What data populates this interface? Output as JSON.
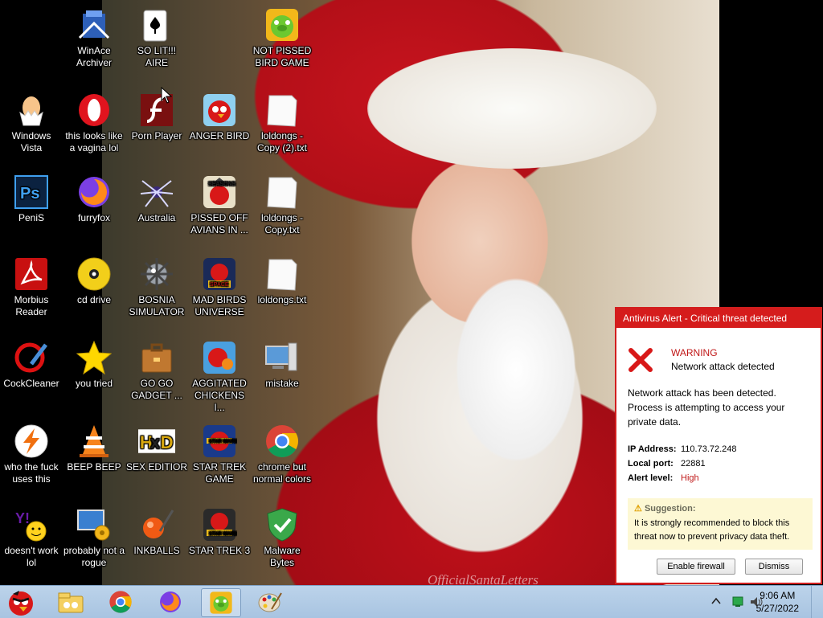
{
  "desktop_icons": [
    {
      "name": "winace-archiver",
      "label": "WinAce Archiver",
      "icon": "archive-icon"
    },
    {
      "name": "solitaire",
      "label": "SO LIT!!! AIRE",
      "icon": "cards-icon"
    },
    {
      "name": "not-pissed-bird",
      "label": "NOT PISSED BIRD GAME",
      "icon": "pig-icon"
    },
    {
      "name": "windows-vista",
      "label": "Windows Vista",
      "icon": "egg-icon"
    },
    {
      "name": "opera",
      "label": "this looks like a vagina lol",
      "icon": "opera-icon"
    },
    {
      "name": "porn-player",
      "label": "Porn Player",
      "icon": "flash-icon"
    },
    {
      "name": "anger-bird",
      "label": "ANGER BIRD",
      "icon": "red-bird-icon"
    },
    {
      "name": "loldongs-copy2",
      "label": "loldongs - Copy (2).txt",
      "icon": "text-file-icon"
    },
    {
      "name": "photoshop",
      "label": "PeniS",
      "icon": "photoshop-icon"
    },
    {
      "name": "firefox",
      "label": "furryfox",
      "icon": "firefox-icon"
    },
    {
      "name": "australia",
      "label": "Australia",
      "icon": "spider-icon"
    },
    {
      "name": "pissed-off-avians",
      "label": "PISSED OFF AVIANS IN ...",
      "icon": "seasons-bird-icon"
    },
    {
      "name": "loldongs-copy",
      "label": "loldongs - Copy.txt",
      "icon": "text-file-icon"
    },
    {
      "name": "morbius-reader",
      "label": "Morbius Reader",
      "icon": "pdf-icon"
    },
    {
      "name": "cd-drive",
      "label": "cd drive",
      "icon": "cd-icon"
    },
    {
      "name": "bosnia-simulator",
      "label": "BOSNIA SIMULATOR",
      "icon": "mine-icon"
    },
    {
      "name": "mad-birds-universe",
      "label": "MAD BIRDS UNIVERSE",
      "icon": "space-bird-icon"
    },
    {
      "name": "loldongs",
      "label": "loldongs.txt",
      "icon": "text-file-icon"
    },
    {
      "name": "cockcleaner",
      "label": "CockCleaner",
      "icon": "broom-icon"
    },
    {
      "name": "you-tried",
      "label": "you tried",
      "icon": "star-icon"
    },
    {
      "name": "go-go-gadget",
      "label": "GO GO GADGET ...",
      "icon": "briefcase-icon"
    },
    {
      "name": "aggitated-chickens",
      "label": "AGGITATED CHICKENS I...",
      "icon": "rio-bird-icon"
    },
    {
      "name": "mistake",
      "label": "mistake",
      "icon": "computer-icon"
    },
    {
      "name": "who-uses-this",
      "label": "who the fuck uses this",
      "icon": "winamp-icon"
    },
    {
      "name": "beep-beep",
      "label": "BEEP BEEP",
      "icon": "vlc-icon"
    },
    {
      "name": "sex-editior",
      "label": "SEX EDITIOR",
      "icon": "hxd-icon"
    },
    {
      "name": "star-trek-game",
      "label": "STAR TREK GAME",
      "icon": "starwars-bird-icon"
    },
    {
      "name": "chrome",
      "label": "chrome but normal colors",
      "icon": "chrome-icon"
    },
    {
      "name": "doesnt-work",
      "label": "doesn't work lol",
      "icon": "yahoo-icon"
    },
    {
      "name": "probably-not-rogue",
      "label": "probably not a rogue",
      "icon": "monitor-gears-icon"
    },
    {
      "name": "inkballs",
      "label": "INKBALLS",
      "icon": "inkball-icon"
    },
    {
      "name": "star-trek-3",
      "label": "STAR TREK 3",
      "icon": "starwars-bird2-icon"
    },
    {
      "name": "malware-bytes",
      "label": "Malware Bytes",
      "icon": "shield-check-icon"
    }
  ],
  "wallpaper": {
    "watermark": "OfficialSantaLetters"
  },
  "antivirus": {
    "title": "Antivirus Alert - Critical threat detected",
    "warning_title": "WARNING",
    "warning_sub": "Network attack detected",
    "message": "Network attack has been detected. Process is attempting to access your private data.",
    "ip_label": "IP Address:",
    "ip_value": "110.73.72.248",
    "port_label": "Local port:",
    "port_value": "22881",
    "level_label": "Alert level:",
    "level_value": "High",
    "suggestion_title": "Suggestion:",
    "suggestion_body": "It is strongly recommended to block this threat now to prevent privacy data theft.",
    "enable_firewall": "Enable firewall",
    "dismiss": "Dismiss",
    "colors": {
      "title_bg": "#d51c1c",
      "warning": "#c01818",
      "suggestion_bg": "#fdf8d4"
    }
  },
  "taskbar": {
    "start_icon": "angry-bird-start-icon",
    "pinned": [
      "file-explorer-icon",
      "chrome-icon",
      "firefox-icon",
      "pig-icon",
      "paint-icon"
    ],
    "time": "9:06 AM",
    "date": "5/27/2022"
  }
}
